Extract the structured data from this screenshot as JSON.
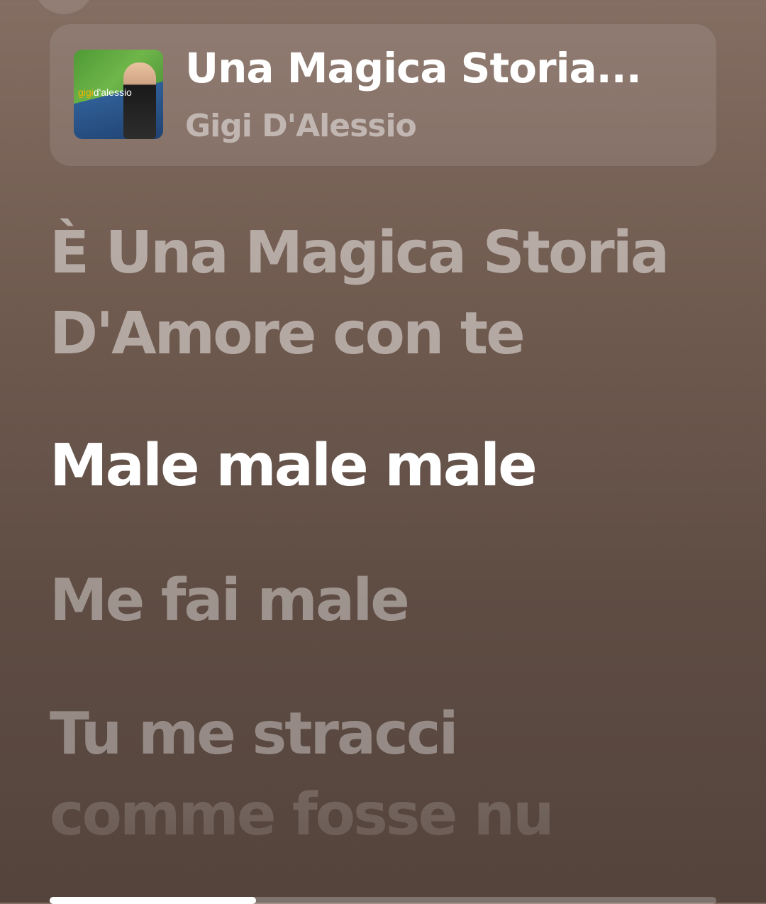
{
  "now_playing": {
    "title": "Una Magica Storia...",
    "artist": "Gigi D'Alessio",
    "album_art_text_first": "gigi",
    "album_art_text_second": "d'alessio"
  },
  "lyrics": {
    "past_line": "È Una Magica Storia D'Amore con te",
    "current_line": "Male male male",
    "next_line_1": "Me fai male",
    "next_line_2": "Tu me stracci",
    "next_line_3": "comme fosse nu"
  },
  "progress": {
    "fraction": 0.31
  }
}
